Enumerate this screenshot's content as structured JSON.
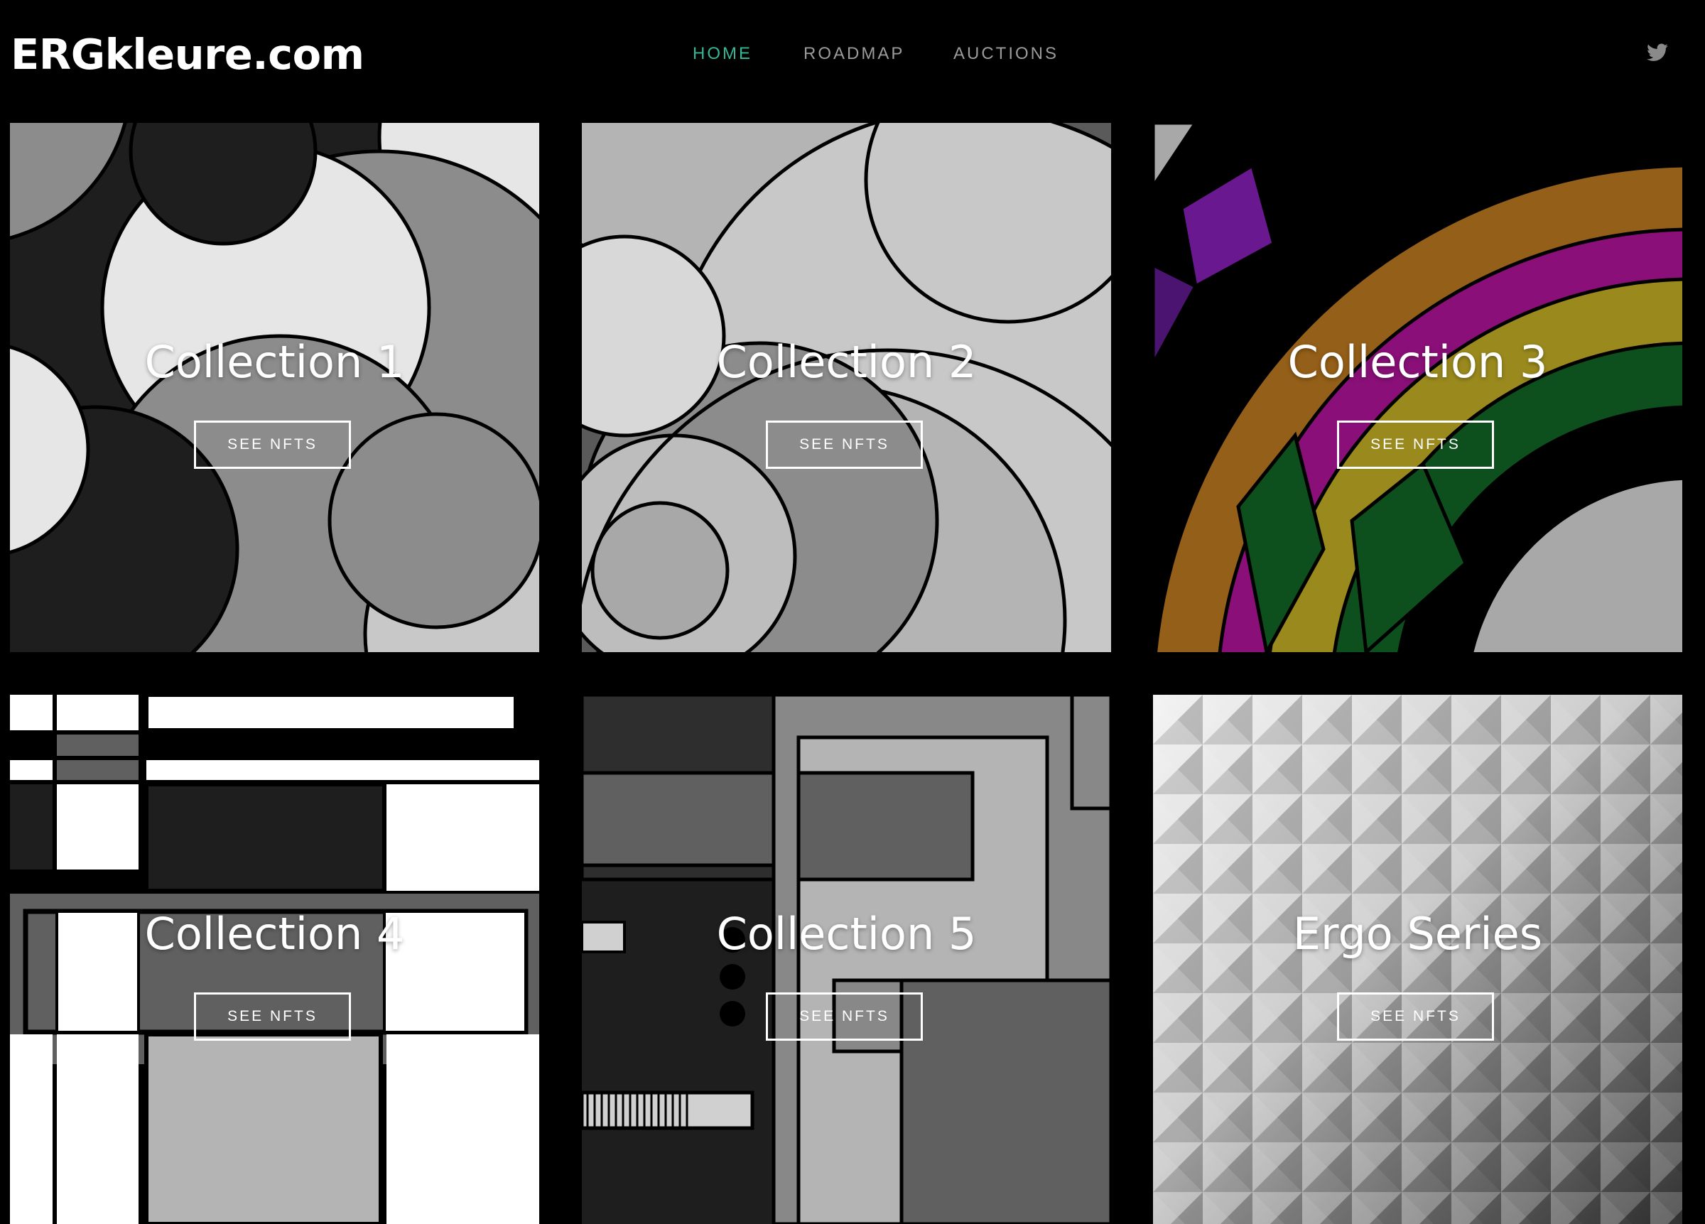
{
  "header": {
    "logo": "ERGkleure.com",
    "nav": [
      {
        "label": "HOME",
        "active": true
      },
      {
        "label": "ROADMAP",
        "active": false
      },
      {
        "label": "AUCTIONS",
        "active": false
      }
    ],
    "social_icon": "twitter-icon"
  },
  "colors": {
    "background": "#000000",
    "nav_active": "#35b795",
    "nav_inactive": "#9b9b9b",
    "text": "#ffffff"
  },
  "collections": [
    {
      "title": "Collection 1",
      "button": "SEE NFTS"
    },
    {
      "title": "Collection 2",
      "button": "SEE NFTS"
    },
    {
      "title": "Collection 3",
      "button": "SEE NFTS"
    },
    {
      "title": "Collection 4",
      "button": "SEE NFTS"
    },
    {
      "title": "Collection 5",
      "button": "SEE NFTS"
    },
    {
      "title": "Ergo Series",
      "button": "SEE NFTS"
    }
  ]
}
